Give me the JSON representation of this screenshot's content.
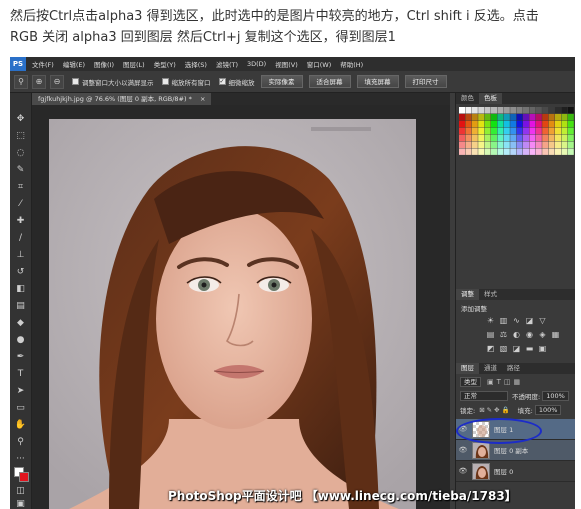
{
  "caption": {
    "line1": "然后按Ctrl点击alpha3 得到选区，此时选中的是图片中较亮的地方，Ctrl shift i 反选。点击",
    "line2": "RGB 关闭 alpha3 回到图层 然后Ctrl+j 复制这个选区，得到图层1"
  },
  "menubar": {
    "logo": "PS",
    "items": [
      "文件(F)",
      "编辑(E)",
      "图像(I)",
      "图层(L)",
      "类型(Y)",
      "选择(S)",
      "滤镜(T)",
      "3D(D)",
      "视图(V)",
      "窗口(W)",
      "帮助(H)"
    ]
  },
  "options": {
    "check_resize": "调整窗口大小以满屏显示",
    "check_all_windows": "缩放所有窗口",
    "check_scrubby": "细微缩放",
    "btn_actual": "实际像素",
    "btn_fit": "适合屏幕",
    "btn_fill": "填充屏幕",
    "btn_print": "打印尺寸"
  },
  "document": {
    "tab_title": "fgjfkuhjkjh.jpg @ 76.6% (图层 0 副本, RGB/8#) *",
    "close": "×"
  },
  "watermark": "PhotoShop平面设计吧 【www.linecg.com/tieba/1783】",
  "panels": {
    "color_tab": "颜色",
    "swatches_tab": "色板",
    "adjustments_tab": "调整",
    "styles_tab": "样式",
    "adjustments_title": "添加调整",
    "layers_tab": "图层",
    "channels_tab": "通道",
    "paths_tab": "路径",
    "kind_label": "类型",
    "blend_mode": "正常",
    "opacity_label": "不透明度:",
    "opacity_value": "100%",
    "lock_label": "锁定:",
    "fill_label": "填充:",
    "fill_value": "100%",
    "layers": [
      {
        "name": "图层 1"
      },
      {
        "name": "图层 0 副本"
      },
      {
        "name": "图层 0"
      }
    ]
  },
  "colors": {
    "accent": "#1c2cc8",
    "selected_layer": "#546a86"
  }
}
